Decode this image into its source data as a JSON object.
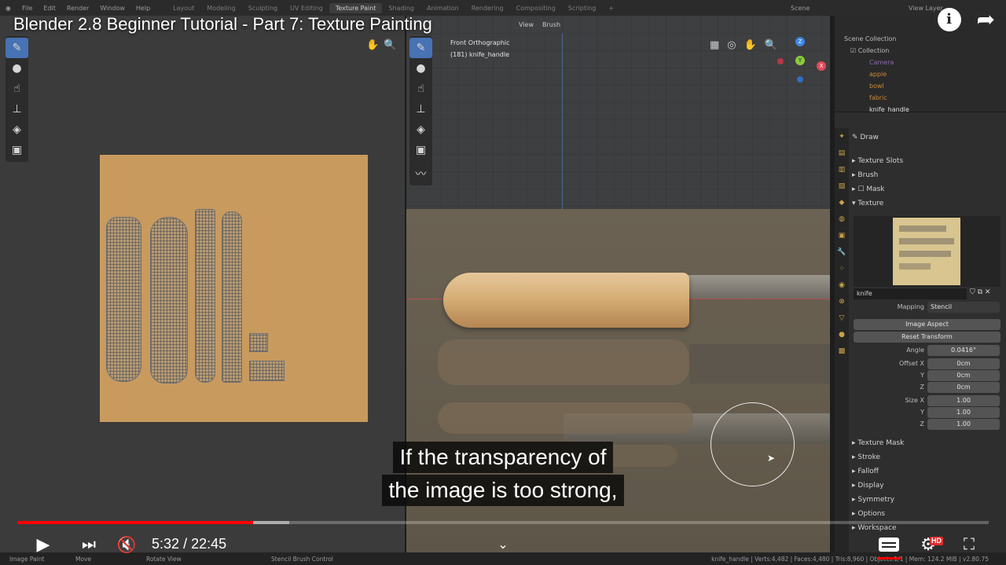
{
  "video": {
    "title": "Blender 2.8 Beginner Tutorial - Part 7: Texture Painting",
    "time_current": "5:32",
    "time_separator": "/",
    "time_total": "22:45",
    "progress_fraction": 0.243,
    "buffer_fraction": 0.28,
    "caption_line1": "If the transparency of",
    "caption_line2": "the image is too strong,",
    "info_icon": "i",
    "hd_badge": "HD"
  },
  "blender": {
    "menu": [
      "File",
      "Edit",
      "Render",
      "Window",
      "Help"
    ],
    "workspaces": [
      "Layout",
      "Modeling",
      "Sculpting",
      "UV Editing",
      "Texture Paint",
      "Shading",
      "Animation",
      "Rendering",
      "Compositing",
      "Scripting"
    ],
    "active_workspace": "Texture Paint",
    "scene_label": "Scene",
    "view_layer_label": "View Layer"
  },
  "viewport": {
    "header_view": "View",
    "header_brush": "Brush",
    "info_line1": "Front Orthographic",
    "info_line2": "(181) knife_handle",
    "gizmo_x": "X",
    "gizmo_y": "Y",
    "gizmo_z": "Z"
  },
  "outliner": {
    "scene_collection": "Scene Collection",
    "collection": "Collection",
    "items": [
      "Camera",
      "apple",
      "bowl",
      "fabric",
      "knife_handle"
    ]
  },
  "properties": {
    "tool_name": "Draw",
    "sections_top": [
      "Texture Slots",
      "Brush",
      "Mask",
      "Texture"
    ],
    "texture_name": "knife",
    "mapping_label": "Mapping",
    "mapping_value": "Stencil",
    "image_aspect": "Image Aspect",
    "reset_transform": "Reset Transform",
    "angle_label": "Angle",
    "angle_value": "0.0416°",
    "offset_x_label": "Offset X",
    "offset_y_label": "Y",
    "offset_z_label": "Z",
    "offset_value": "0cm",
    "size_x_label": "Size X",
    "size_y_label": "Y",
    "size_z_label": "Z",
    "size_value": "1.00",
    "sections_bottom": [
      "Texture Mask",
      "Stroke",
      "Falloff",
      "Display",
      "Symmetry",
      "Options",
      "Workspace"
    ]
  },
  "statusbar": {
    "left_items": [
      "Image Paint",
      "Move",
      "Rotate View",
      "Stencil Brush Control"
    ],
    "right_info": "knife_handle | Verts:4,482 | Faces:4,480 | Tris:8,960 | Objects:1/1 | Mem: 124.2 MiB | v2.80.75"
  },
  "colors": {
    "progress_red": "#ff0000",
    "blender_accent": "#4772b3",
    "uv_background": "#c99a5e"
  },
  "icons": [
    "play-icon",
    "next-icon",
    "mute-icon",
    "chevron-down-icon",
    "subtitles-icon",
    "settings-icon",
    "exit-fullscreen-icon",
    "info-icon",
    "share-icon"
  ]
}
